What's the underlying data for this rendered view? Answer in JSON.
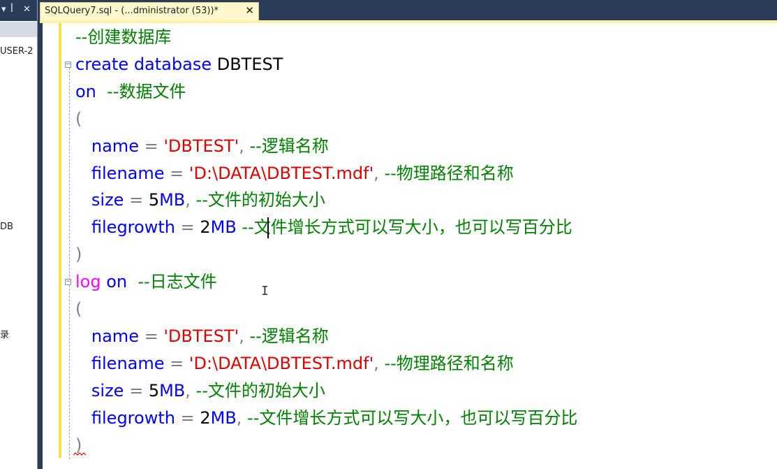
{
  "left_panel": {
    "header_icons": [
      "▾",
      "ꟾ",
      "✕"
    ],
    "tree_fragments": [
      "USER-2",
      "DB",
      "录"
    ]
  },
  "tab": {
    "title": "SQLQuery7.sql - (...dministrator (53))*",
    "close": "✕"
  },
  "editor": {
    "cursor_line": 8,
    "lines": [
      [
        [
          "cm",
          "--创建数据库"
        ]
      ],
      [
        [
          "kw",
          "create database "
        ],
        [
          "id",
          "DBTEST"
        ]
      ],
      [
        [
          "kw",
          "on"
        ],
        [
          "cm",
          "  --数据文件"
        ]
      ],
      [
        [
          "op",
          "("
        ]
      ],
      [
        [
          "id",
          "   "
        ],
        [
          "kw",
          "name"
        ],
        [
          "op",
          " = "
        ],
        [
          "str",
          "'DBTEST'"
        ],
        [
          "op",
          ", "
        ],
        [
          "cm",
          "--逻辑名称"
        ]
      ],
      [
        [
          "id",
          "   "
        ],
        [
          "kw",
          "filename"
        ],
        [
          "op",
          " = "
        ],
        [
          "str",
          "'D:\\DATA\\DBTEST.mdf'"
        ],
        [
          "op",
          ", "
        ],
        [
          "cm",
          "--物理路径和名称"
        ]
      ],
      [
        [
          "id",
          "   "
        ],
        [
          "kw",
          "size"
        ],
        [
          "op",
          " = "
        ],
        [
          "num",
          "5"
        ],
        [
          "kw",
          "MB"
        ],
        [
          "op",
          ", "
        ],
        [
          "cm",
          "--文件的初始大小"
        ]
      ],
      [
        [
          "id",
          "   "
        ],
        [
          "kw",
          "filegrowth"
        ],
        [
          "op",
          " = "
        ],
        [
          "num",
          "2"
        ],
        [
          "kw",
          "MB"
        ],
        [
          "op",
          " "
        ],
        [
          "cm",
          "--文件增长方式可以写大小，也可以写百分比"
        ]
      ],
      [
        [
          "op",
          ")"
        ]
      ],
      [
        [
          "fn",
          "log"
        ],
        [
          "op",
          " "
        ],
        [
          "kw",
          "on"
        ],
        [
          "cm",
          "  --日志文件"
        ]
      ],
      [
        [
          "op",
          "("
        ]
      ],
      [
        [
          "id",
          "   "
        ],
        [
          "kw",
          "name"
        ],
        [
          "op",
          " = "
        ],
        [
          "str",
          "'DBTEST'"
        ],
        [
          "op",
          ", "
        ],
        [
          "cm",
          "--逻辑名称"
        ]
      ],
      [
        [
          "id",
          "   "
        ],
        [
          "kw",
          "filename"
        ],
        [
          "op",
          " = "
        ],
        [
          "str",
          "'D:\\DATA\\DBTEST.mdf'"
        ],
        [
          "op",
          ", "
        ],
        [
          "cm",
          "--物理路径和名称"
        ]
      ],
      [
        [
          "id",
          "   "
        ],
        [
          "kw",
          "size"
        ],
        [
          "op",
          " = "
        ],
        [
          "num",
          "5"
        ],
        [
          "kw",
          "MB"
        ],
        [
          "op",
          ", "
        ],
        [
          "cm",
          "--文件的初始大小"
        ]
      ],
      [
        [
          "id",
          "   "
        ],
        [
          "kw",
          "filegrowth"
        ],
        [
          "op",
          " = "
        ],
        [
          "num",
          "2"
        ],
        [
          "kw",
          "MB"
        ],
        [
          "op",
          ", "
        ],
        [
          "cm",
          "--文件增长方式可以写大小，也可以写百分比"
        ]
      ],
      [
        [
          "op",
          ")"
        ]
      ]
    ]
  }
}
